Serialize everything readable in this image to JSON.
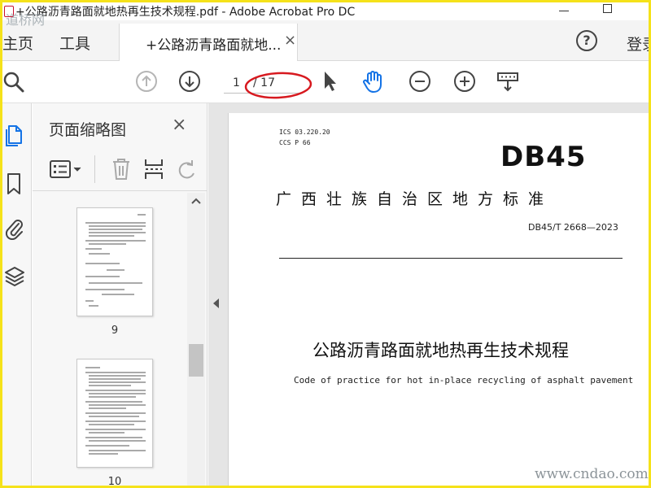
{
  "window": {
    "title": "+公路沥青路面就地热再生技术规程.pdf - Adobe Acrobat Pro DC"
  },
  "tabs": {
    "home": "主页",
    "tools": "工具",
    "document": "+公路沥青路面就地...",
    "close_glyph": "×",
    "help_glyph": "?",
    "login": "登录"
  },
  "toolbar": {
    "page_current": "1",
    "page_total": "/ 17",
    "icons": [
      "search-icon",
      "prev-page-icon",
      "next-page-icon",
      "select-cursor-icon",
      "hand-tool-icon",
      "zoom-out-icon",
      "zoom-in-icon",
      "fit-page-icon"
    ],
    "accent_color": "#1473e6",
    "highlight_color": "#d7191f"
  },
  "sidebar": {
    "rail_icons": [
      "page-thumbnails-icon",
      "bookmark-icon",
      "attachment-icon",
      "layers-icon"
    ],
    "panel_title": "页面缩略图",
    "close_glyph": "×",
    "thumbnails": [
      {
        "label": "9"
      },
      {
        "label": "10"
      }
    ]
  },
  "document": {
    "ics": "ICS  03.220.20",
    "ccs": "CCS  P 66",
    "logo": "DB45",
    "region_title": "广西壮族自治区地方标准",
    "standard_number": "DB45/T 2668—2023",
    "title_cn": "公路沥青路面就地热再生技术规程",
    "title_en": "Code of practice for hot in-place recycling of asphalt pavement"
  },
  "watermarks": {
    "top": "道桥网",
    "bottom": "www.cndao.com"
  }
}
